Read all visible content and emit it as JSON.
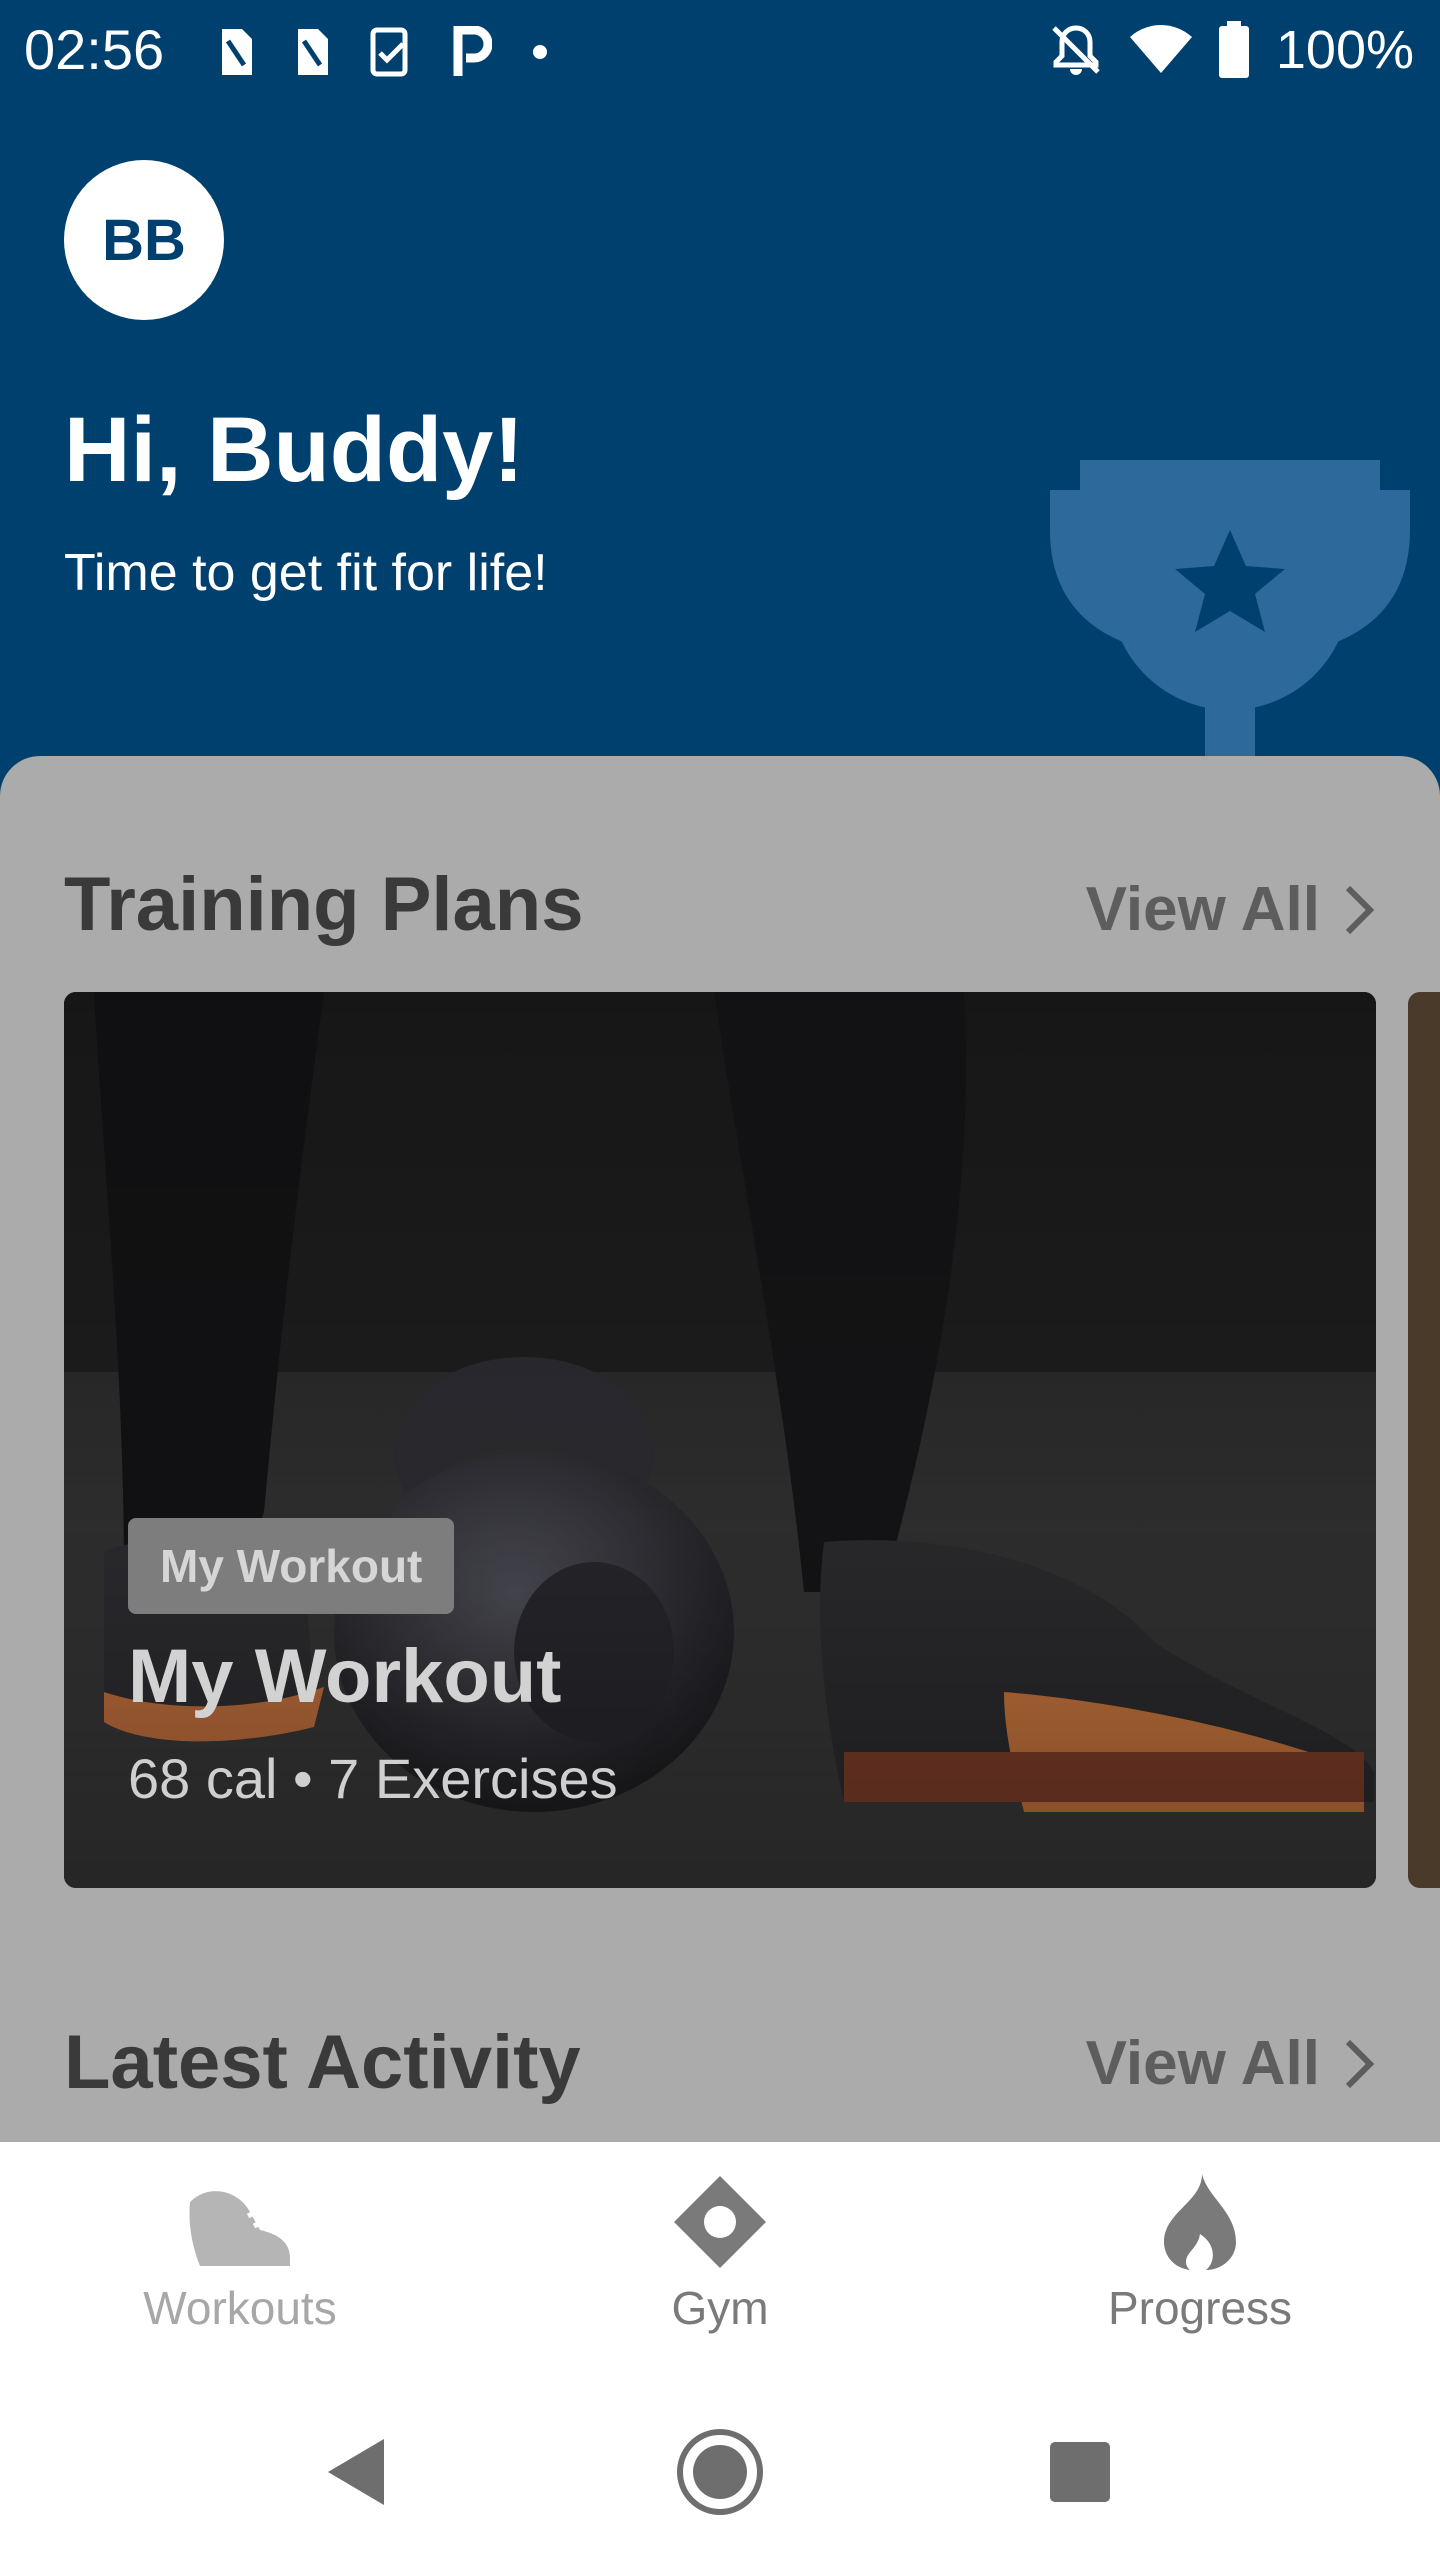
{
  "status_bar": {
    "time": "02:56",
    "battery": "100%",
    "icons_left": [
      "sim-card-icon",
      "sim-card-icon",
      "task-icon",
      "parking-icon",
      "dot-icon"
    ],
    "icons_right": [
      "notifications-off-icon",
      "wifi-icon",
      "battery-icon"
    ]
  },
  "header": {
    "avatar_initials": "BB",
    "greeting": "Hi, Buddy!",
    "subtitle": "Time to get fit for life!",
    "background_color": "#00406f",
    "decoration_icon": "trophy-icon"
  },
  "training_plans": {
    "title": "Training Plans",
    "view_all": "View All",
    "cards": [
      {
        "badge": "My Workout",
        "title": "My Workout",
        "meta": "68 cal • 7 Exercises"
      }
    ]
  },
  "latest_activity": {
    "title": "Latest Activity",
    "view_all": "View All"
  },
  "bottom_nav": {
    "items": [
      {
        "label": "Workouts",
        "icon": "shoe-icon"
      },
      {
        "label": "Gym",
        "icon": "location-diamond-icon"
      },
      {
        "label": "Progress",
        "icon": "flame-icon"
      }
    ]
  },
  "system_nav": {
    "buttons": [
      "back-icon",
      "home-icon",
      "recents-icon"
    ]
  }
}
